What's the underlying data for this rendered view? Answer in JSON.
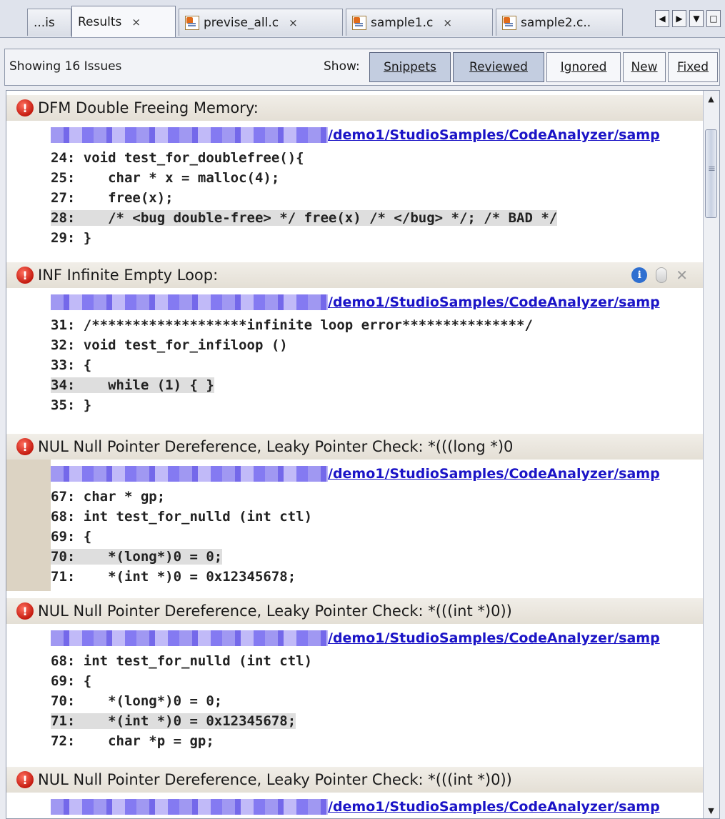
{
  "tabs": [
    {
      "label": "...is",
      "active": false,
      "has_close": false,
      "has_icon": false
    },
    {
      "label": "Results",
      "active": true,
      "has_close": true,
      "has_icon": false
    },
    {
      "label": "previse_all.c",
      "active": false,
      "has_close": true,
      "has_icon": true
    },
    {
      "label": "sample1.c",
      "active": false,
      "has_close": true,
      "has_icon": true
    },
    {
      "label": "sample2.c..",
      "active": false,
      "has_close": false,
      "has_icon": true
    }
  ],
  "tab_close_glyph": "×",
  "tab_nav": {
    "left": "◀",
    "right": "▶",
    "menu": "▼",
    "maximize": "□"
  },
  "toolbar": {
    "status": "Showing 16 Issues",
    "show_label": "Show:",
    "filters": [
      {
        "label": "Snippets",
        "on": true
      },
      {
        "label": "Reviewed",
        "on": true
      },
      {
        "label": "Ignored",
        "on": false
      },
      {
        "label": "New",
        "on": false
      },
      {
        "label": "Fixed",
        "on": false
      }
    ]
  },
  "scroll": {
    "up": "▲",
    "down": "▼"
  },
  "issues": [
    {
      "title": "DFM Double Freeing Memory:",
      "path": "/demo1/StudioSamples/CodeAnalyzer/samp",
      "lines": [
        {
          "text": "24: void test_for_doublefree(){",
          "highlight": false
        },
        {
          "text": "25:    char * x = malloc(4);",
          "highlight": false
        },
        {
          "text": "27:    free(x);",
          "highlight": false
        },
        {
          "text": "28:    /* <bug double-free> */ free(x) /* </bug> */; /* BAD */",
          "highlight": true
        },
        {
          "text": "29: }",
          "highlight": false
        }
      ],
      "actions": false
    },
    {
      "title": "INF Infinite Empty Loop:",
      "path": "/demo1/StudioSamples/CodeAnalyzer/samp",
      "lines": [
        {
          "text": "31: /*******************infinite loop error***************/",
          "highlight": false
        },
        {
          "text": "32: void test_for_infiloop ()",
          "highlight": false
        },
        {
          "text": "33: {",
          "highlight": false
        },
        {
          "text": "34:    while (1) { }",
          "highlight": true
        },
        {
          "text": "35: }",
          "highlight": false
        }
      ],
      "actions": true
    },
    {
      "title": "NUL Null Pointer Dereference, Leaky Pointer Check: *(((long *)0",
      "path": "/demo1/StudioSamples/CodeAnalyzer/samp",
      "lines": [
        {
          "text": "67: char * gp;",
          "highlight": false
        },
        {
          "text": "68: int test_for_nulld (int ctl)",
          "highlight": false
        },
        {
          "text": "69: {",
          "highlight": false
        },
        {
          "text": "70:    *(long*)0 = 0;",
          "highlight": true
        },
        {
          "text": "71:    *(int *)0 = 0x12345678;",
          "highlight": false
        }
      ],
      "actions": false
    },
    {
      "title": "NUL Null Pointer Dereference, Leaky Pointer Check: *(((int *)0))",
      "path": "/demo1/StudioSamples/CodeAnalyzer/samp",
      "lines": [
        {
          "text": "68: int test_for_nulld (int ctl)",
          "highlight": false
        },
        {
          "text": "69: {",
          "highlight": false
        },
        {
          "text": "70:    *(long*)0 = 0;",
          "highlight": false
        },
        {
          "text": "71:    *(int *)0 = 0x12345678;",
          "highlight": true
        },
        {
          "text": "72:    char *p = gp;",
          "highlight": false
        }
      ],
      "actions": false
    },
    {
      "title": "NUL Null Pointer Dereference, Leaky Pointer Check: *(((int *)0))",
      "path": "/demo1/StudioSamples/CodeAnalyzer/samp",
      "lines": [],
      "actions": false
    }
  ],
  "icons": {
    "error": "error-icon",
    "info": "info-icon",
    "toggle": "toggle-icon",
    "dismiss": "dismiss-icon"
  },
  "colors": {
    "link": "#1b14c7",
    "highlight": "#dedede",
    "header_bg": "#e4dfd5",
    "active_filter": "#c3cde0",
    "error_red": "#c41b10",
    "info_blue": "#2f6fd0"
  }
}
